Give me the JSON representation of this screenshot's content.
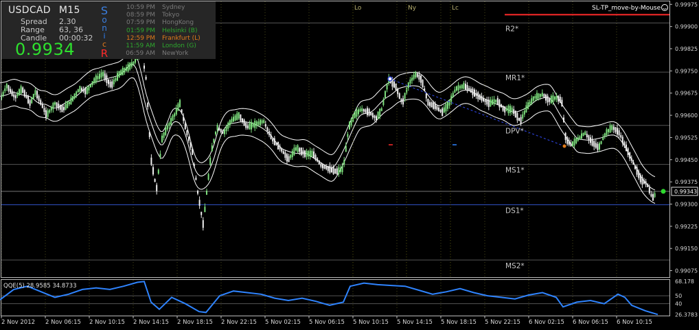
{
  "info": {
    "symbol": "USDCAD",
    "timeframe": "M15",
    "spread_label": "Spread",
    "spread_value": "2.30",
    "range_label": "Range",
    "range_value": "63, 36",
    "candle_label": "Candle",
    "candle_value": "00:00:32",
    "price": "0.9934",
    "sonic_letters": [
      "S",
      "o",
      "n",
      "i",
      "c",
      "R"
    ]
  },
  "sessions": [
    {
      "time": "10:59 PM",
      "city": "Sydney",
      "color": "#7a7a7a"
    },
    {
      "time": "08:59 PM",
      "city": "Tokyo",
      "color": "#7a7a7a"
    },
    {
      "time": "07:59 PM",
      "city": "HongKong",
      "color": "#7a7a7a"
    },
    {
      "time": "01:59 PM",
      "city": "Helsinki  (B)",
      "color": "#2ea82e"
    },
    {
      "time": "12:59 PM",
      "city": "Frankfurt  (L)",
      "color": "#e07a1a"
    },
    {
      "time": "11:59 AM",
      "city": "London  (G)",
      "color": "#2ea82e"
    },
    {
      "time": "06:59 AM",
      "city": "NewYork",
      "color": "#7a7a7a"
    }
  ],
  "session_markers": [
    "Lo",
    "Ny",
    "Lc"
  ],
  "script_label": "SL-TP_move-by-Mouse",
  "pivots": [
    {
      "label": "R2*",
      "value": 0.99912,
      "color": "#555555"
    },
    {
      "label": "MR1*",
      "value": 0.99746,
      "color": "#555555"
    },
    {
      "label": "DPV*",
      "value": 0.99566,
      "color": "#555555"
    },
    {
      "label": "MS1*",
      "value": 0.99434,
      "color": "#555555"
    },
    {
      "label": "DS1*",
      "value": 0.99298,
      "color": "#3355cc"
    },
    {
      "label": "MS2*",
      "value": 0.99111,
      "color": "#555555"
    }
  ],
  "pivot_top_line": {
    "value": 0.9994,
    "color": "#ff2a2a"
  },
  "qqe_label": "QQE(5) 28.9585 34.8733",
  "colors": {
    "candle_up": "#7ee07e",
    "candle_down": "#f0f0f0",
    "band": "#ffffff",
    "grid": "#3d3d3d",
    "axis_text": "#d8d8d8",
    "qqe_line": "#2f84ff",
    "price_marker": "#2ed82e",
    "trend": "#2a3fd0"
  },
  "chart_data": {
    "type": "candlestick",
    "title": "USDCAD M15",
    "y_axis": {
      "ticks": [
        "0.99975",
        "0.99900",
        "0.99825",
        "0.99750",
        "0.99675",
        "0.99600",
        "0.99525",
        "0.99450",
        "0.99375",
        "0.99300",
        "0.99225",
        "0.99150",
        "0.99075"
      ],
      "ylim": [
        0.99053,
        0.99985
      ]
    },
    "current_price": 0.99343,
    "current_price_label": "0.99343",
    "x_axis": {
      "ticks": [
        "2 Nov 2012",
        "2 Nov 06:15",
        "2 Nov 10:15",
        "2 Nov 14:15",
        "2 Nov 18:15",
        "2 Nov 22:15",
        "5 Nov 02:15",
        "5 Nov 06:15",
        "5 Nov 10:15",
        "5 Nov 14:15",
        "5 Nov 18:15",
        "5 Nov 22:15",
        "6 Nov 02:15",
        "6 Nov 06:15",
        "6 Nov 10:15"
      ]
    },
    "price_path": [
      [
        0,
        0.9965
      ],
      [
        10,
        0.997
      ],
      [
        22,
        0.9966
      ],
      [
        32,
        0.9969
      ],
      [
        44,
        0.9964
      ],
      [
        52,
        0.9968
      ],
      [
        60,
        0.9964
      ],
      [
        68,
        0.996
      ],
      [
        80,
        0.9964
      ],
      [
        92,
        0.9962
      ],
      [
        104,
        0.9965
      ],
      [
        116,
        0.9969
      ],
      [
        126,
        0.9968
      ],
      [
        138,
        0.9972
      ],
      [
        150,
        0.9974
      ],
      [
        162,
        0.997
      ],
      [
        174,
        0.9974
      ],
      [
        186,
        0.9976
      ],
      [
        196,
        0.9978
      ],
      [
        206,
        0.9982
      ],
      [
        213,
        0.9972
      ],
      [
        220,
        0.9945
      ],
      [
        228,
        0.9935
      ],
      [
        236,
        0.9952
      ],
      [
        244,
        0.9956
      ],
      [
        254,
        0.996
      ],
      [
        262,
        0.9964
      ],
      [
        270,
        0.9956
      ],
      [
        280,
        0.9948
      ],
      [
        288,
        0.9934
      ],
      [
        296,
        0.9923
      ],
      [
        302,
        0.9936
      ],
      [
        308,
        0.9948
      ],
      [
        316,
        0.9956
      ],
      [
        326,
        0.9954
      ],
      [
        336,
        0.9958
      ],
      [
        348,
        0.996
      ],
      [
        360,
        0.9956
      ],
      [
        372,
        0.9957
      ],
      [
        384,
        0.9958
      ],
      [
        396,
        0.9952
      ],
      [
        408,
        0.9949
      ],
      [
        420,
        0.9945
      ],
      [
        432,
        0.9949
      ],
      [
        444,
        0.9947
      ],
      [
        456,
        0.9947
      ],
      [
        468,
        0.9943
      ],
      [
        478,
        0.9942
      ],
      [
        490,
        0.9941
      ],
      [
        500,
        0.9942
      ],
      [
        508,
        0.9956
      ],
      [
        516,
        0.996
      ],
      [
        526,
        0.9962
      ],
      [
        538,
        0.9961
      ],
      [
        548,
        0.9959
      ],
      [
        556,
        0.9962
      ],
      [
        566,
        0.9972
      ],
      [
        576,
        0.997
      ],
      [
        586,
        0.9964
      ],
      [
        596,
        0.9971
      ],
      [
        606,
        0.9974
      ],
      [
        614,
        0.9972
      ],
      [
        624,
        0.9964
      ],
      [
        634,
        0.9963
      ],
      [
        644,
        0.9961
      ],
      [
        654,
        0.9964
      ],
      [
        664,
        0.9969
      ],
      [
        676,
        0.997
      ],
      [
        688,
        0.9968
      ],
      [
        700,
        0.9966
      ],
      [
        712,
        0.9964
      ],
      [
        724,
        0.9965
      ],
      [
        734,
        0.9962
      ],
      [
        746,
        0.9962
      ],
      [
        758,
        0.9958
      ],
      [
        768,
        0.9963
      ],
      [
        778,
        0.9966
      ],
      [
        790,
        0.9967
      ],
      [
        800,
        0.9965
      ],
      [
        810,
        0.9966
      ],
      [
        818,
        0.9965
      ],
      [
        824,
        0.9952
      ],
      [
        832,
        0.995
      ],
      [
        842,
        0.9952
      ],
      [
        852,
        0.9954
      ],
      [
        862,
        0.9951
      ],
      [
        872,
        0.9949
      ],
      [
        882,
        0.9954
      ],
      [
        892,
        0.9956
      ],
      [
        902,
        0.9954
      ],
      [
        910,
        0.995
      ],
      [
        918,
        0.9946
      ],
      [
        926,
        0.9942
      ],
      [
        934,
        0.9938
      ],
      [
        942,
        0.9937
      ],
      [
        950,
        0.9932
      ],
      [
        958,
        0.99343
      ]
    ],
    "qqe": {
      "label": "QQE(5) 28.9585 34.8733",
      "ticks": [
        "68.178",
        "50",
        "40",
        "26.3783"
      ],
      "tick_values": [
        68.178,
        50,
        40,
        26.3783
      ],
      "ylim": [
        25,
        70
      ],
      "values": [
        [
          0,
          45
        ],
        [
          20,
          58
        ],
        [
          40,
          62
        ],
        [
          60,
          55
        ],
        [
          80,
          48
        ],
        [
          100,
          52
        ],
        [
          120,
          58
        ],
        [
          140,
          60
        ],
        [
          160,
          58
        ],
        [
          180,
          62
        ],
        [
          200,
          67
        ],
        [
          210,
          68
        ],
        [
          220,
          42
        ],
        [
          232,
          33
        ],
        [
          250,
          48
        ],
        [
          270,
          40
        ],
        [
          290,
          30
        ],
        [
          300,
          29
        ],
        [
          320,
          50
        ],
        [
          340,
          56
        ],
        [
          360,
          54
        ],
        [
          380,
          52
        ],
        [
          400,
          47
        ],
        [
          420,
          44
        ],
        [
          440,
          47
        ],
        [
          460,
          43
        ],
        [
          480,
          38
        ],
        [
          500,
          42
        ],
        [
          510,
          62
        ],
        [
          530,
          66
        ],
        [
          550,
          64
        ],
        [
          570,
          63
        ],
        [
          590,
          62
        ],
        [
          610,
          57
        ],
        [
          630,
          52
        ],
        [
          650,
          55
        ],
        [
          670,
          59
        ],
        [
          690,
          54
        ],
        [
          710,
          50
        ],
        [
          730,
          48
        ],
        [
          750,
          46
        ],
        [
          770,
          51
        ],
        [
          790,
          54
        ],
        [
          810,
          48
        ],
        [
          820,
          36
        ],
        [
          840,
          42
        ],
        [
          860,
          44
        ],
        [
          880,
          40
        ],
        [
          900,
          52
        ],
        [
          910,
          48
        ],
        [
          920,
          38
        ],
        [
          940,
          31
        ],
        [
          958,
          26.3783
        ]
      ]
    }
  }
}
